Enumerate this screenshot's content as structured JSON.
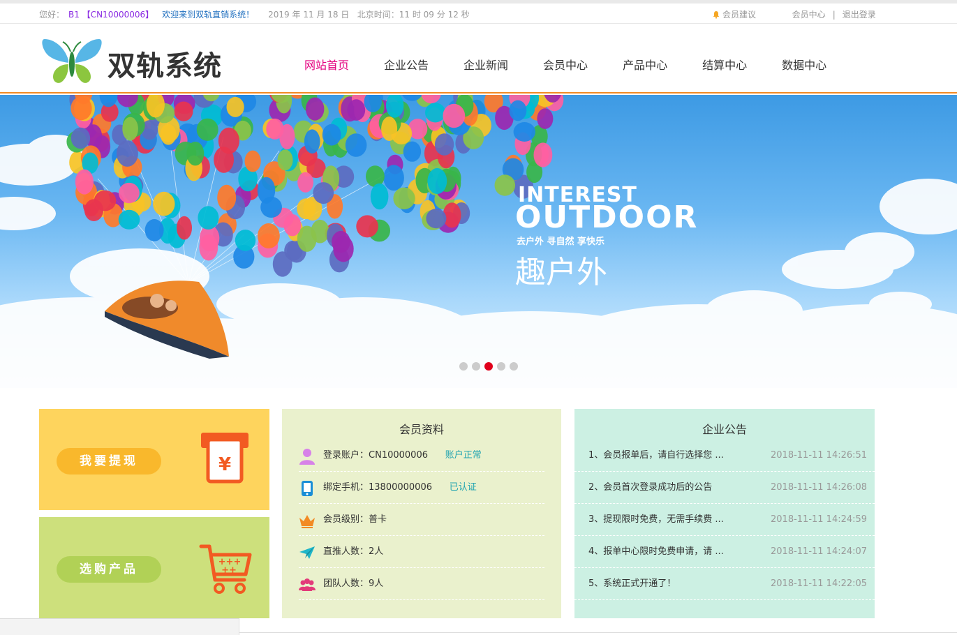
{
  "topbar": {
    "greeting": "您好：",
    "user": "B1 【CN10000006】",
    "welcome": "欢迎来到双轨直销系统！",
    "date": "2019 年 11 月 18 日",
    "time": "北京时间：11 时 09 分 12 秒",
    "suggest": "会员建议",
    "member_center": "会员中心",
    "separator": "|",
    "logout": "退出登录"
  },
  "header": {
    "logo_text": "双轨系统",
    "nav": [
      "网站首页",
      "企业公告",
      "企业新闻",
      "会员中心",
      "产品中心",
      "结算中心",
      "数据中心"
    ],
    "active_index": 0
  },
  "banner": {
    "line1": "INTEREST",
    "line2": "OUTDOOR",
    "sub": "去户外 寻自然 享快乐",
    "big": "趣户外",
    "slides": 5,
    "active_slide": 3
  },
  "cards": {
    "withdraw": "我要提现",
    "shop": "选购产品"
  },
  "member": {
    "title": "会员资料",
    "rows": [
      {
        "icon": "user-icon",
        "label": "登录账户：",
        "value": "CN10000006",
        "tag": "账户正常"
      },
      {
        "icon": "phone-icon",
        "label": "绑定手机：",
        "value": "13800000006",
        "tag": "已认证"
      },
      {
        "icon": "crown-icon",
        "label": "会员级别：",
        "value": "普卡",
        "tag": ""
      },
      {
        "icon": "paper-plane-icon",
        "label": "直推人数：",
        "value": "2人",
        "tag": ""
      },
      {
        "icon": "group-icon",
        "label": "团队人数：",
        "value": "9人",
        "tag": ""
      }
    ]
  },
  "notice": {
    "title": "企业公告",
    "rows": [
      {
        "text": "1、会员报单后，请自行选择您 ...",
        "date": "2018-11-11 14:26:51"
      },
      {
        "text": "2、会员首次登录成功后的公告",
        "date": "2018-11-11 14:26:08"
      },
      {
        "text": "3、提现限时免费，无需手续费 ...",
        "date": "2018-11-11 14:24:59"
      },
      {
        "text": "4、报单中心限时免费申请，请 ...",
        "date": "2018-11-11 14:24:07"
      },
      {
        "text": "5、系统正式开通了！",
        "date": "2018-11-11 14:22:05"
      }
    ]
  },
  "colors": {
    "accent_nav": "#e4007f",
    "header_border": "#f28a24",
    "tag": "#1fa3b0",
    "dot_active": "#e0001b"
  }
}
